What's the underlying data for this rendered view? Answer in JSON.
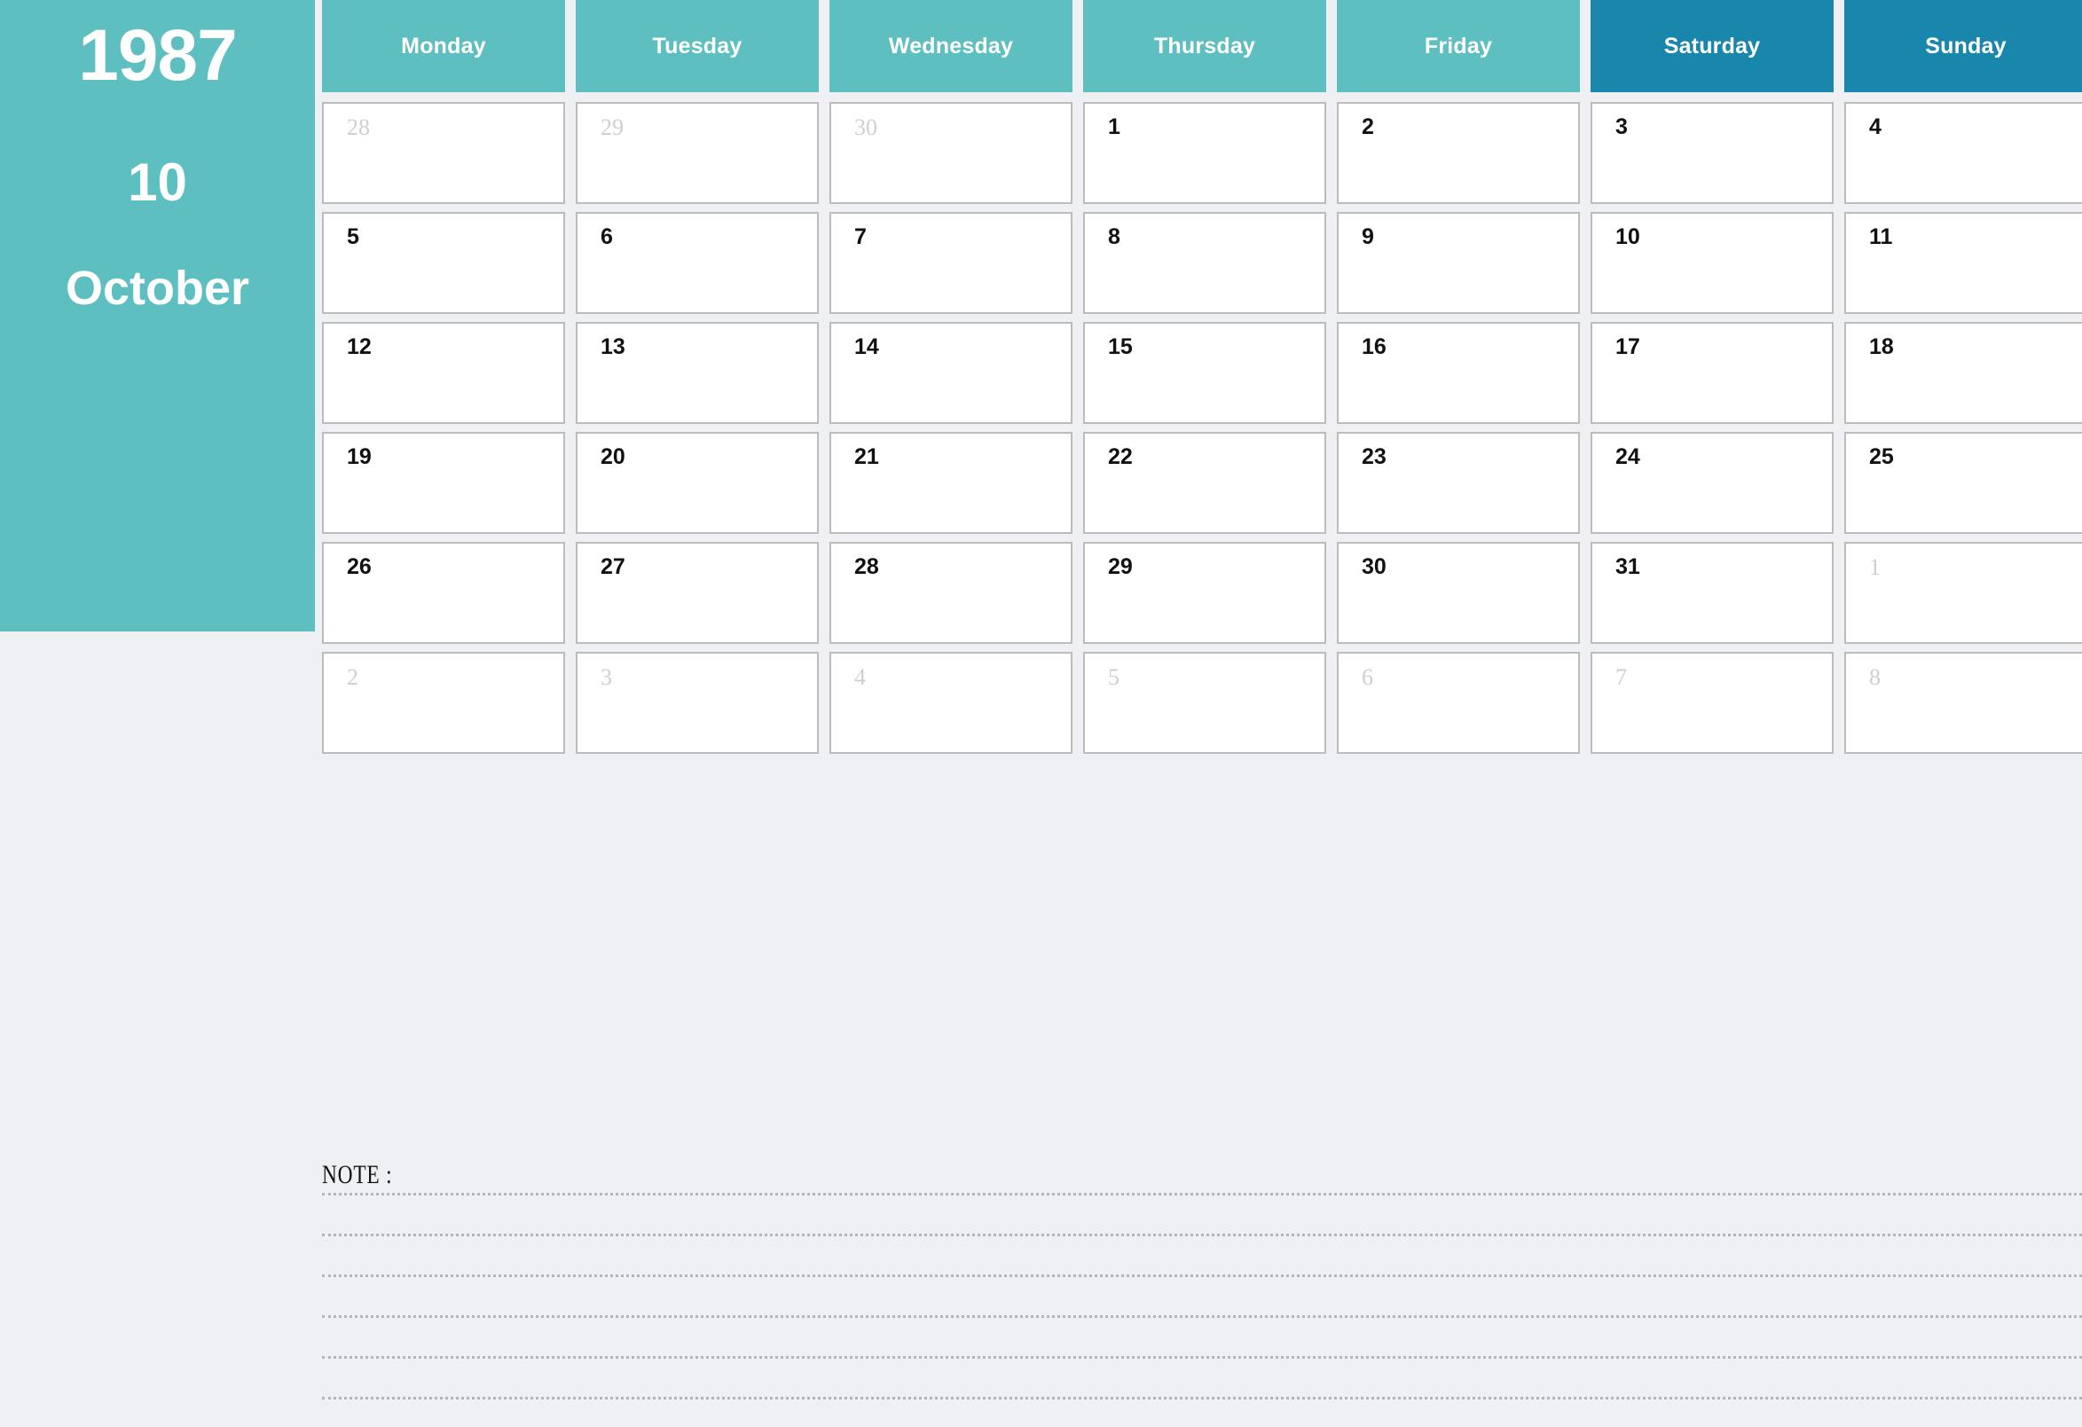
{
  "sidebar": {
    "year": "1987",
    "month_number": "10",
    "month_name": "October"
  },
  "colors": {
    "teal": "#5ebfc0",
    "weekend_blue": "#1887ab",
    "page_background": "#eff0f4",
    "cell_border": "#bcbcbc",
    "other_month_text": "#cfcfcf",
    "in_month_text": "#111111"
  },
  "header": {
    "days": [
      {
        "label": "Monday",
        "weekend": false
      },
      {
        "label": "Tuesday",
        "weekend": false
      },
      {
        "label": "Wednesday",
        "weekend": false
      },
      {
        "label": "Thursday",
        "weekend": false
      },
      {
        "label": "Friday",
        "weekend": false
      },
      {
        "label": "Saturday",
        "weekend": true
      },
      {
        "label": "Sunday",
        "weekend": true
      }
    ]
  },
  "calendar": {
    "weeks": [
      [
        {
          "day": "28",
          "in_month": false
        },
        {
          "day": "29",
          "in_month": false
        },
        {
          "day": "30",
          "in_month": false
        },
        {
          "day": "1",
          "in_month": true
        },
        {
          "day": "2",
          "in_month": true
        },
        {
          "day": "3",
          "in_month": true
        },
        {
          "day": "4",
          "in_month": true
        }
      ],
      [
        {
          "day": "5",
          "in_month": true
        },
        {
          "day": "6",
          "in_month": true
        },
        {
          "day": "7",
          "in_month": true
        },
        {
          "day": "8",
          "in_month": true
        },
        {
          "day": "9",
          "in_month": true
        },
        {
          "day": "10",
          "in_month": true
        },
        {
          "day": "11",
          "in_month": true
        }
      ],
      [
        {
          "day": "12",
          "in_month": true
        },
        {
          "day": "13",
          "in_month": true
        },
        {
          "day": "14",
          "in_month": true
        },
        {
          "day": "15",
          "in_month": true
        },
        {
          "day": "16",
          "in_month": true
        },
        {
          "day": "17",
          "in_month": true
        },
        {
          "day": "18",
          "in_month": true
        }
      ],
      [
        {
          "day": "19",
          "in_month": true
        },
        {
          "day": "20",
          "in_month": true
        },
        {
          "day": "21",
          "in_month": true
        },
        {
          "day": "22",
          "in_month": true
        },
        {
          "day": "23",
          "in_month": true
        },
        {
          "day": "24",
          "in_month": true
        },
        {
          "day": "25",
          "in_month": true
        }
      ],
      [
        {
          "day": "26",
          "in_month": true
        },
        {
          "day": "27",
          "in_month": true
        },
        {
          "day": "28",
          "in_month": true
        },
        {
          "day": "29",
          "in_month": true
        },
        {
          "day": "30",
          "in_month": true
        },
        {
          "day": "31",
          "in_month": true
        },
        {
          "day": "1",
          "in_month": false
        }
      ],
      [
        {
          "day": "2",
          "in_month": false
        },
        {
          "day": "3",
          "in_month": false
        },
        {
          "day": "4",
          "in_month": false
        },
        {
          "day": "5",
          "in_month": false
        },
        {
          "day": "6",
          "in_month": false
        },
        {
          "day": "7",
          "in_month": false
        },
        {
          "day": "8",
          "in_month": false
        }
      ]
    ]
  },
  "note": {
    "label": "NOTE :",
    "line_count": 6
  }
}
